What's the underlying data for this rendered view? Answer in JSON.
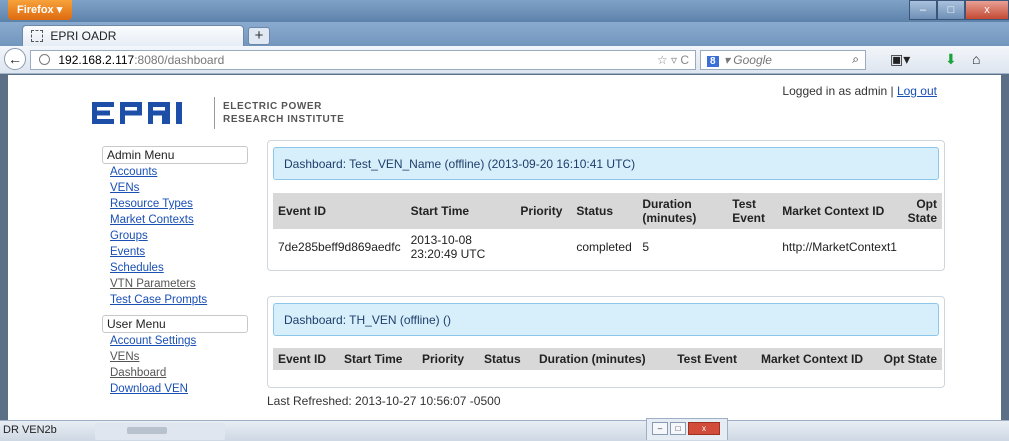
{
  "browser": {
    "menu_button": "Firefox",
    "tab_title": "EPRI OADR",
    "new_tab_glyph": "+",
    "url_host": "192.168.2.117",
    "url_path": ":8080/dashboard",
    "url_controls": "☆ ▿ C",
    "search_engine": "8",
    "search_placeholder": "Google",
    "window_controls": {
      "minimize": "–",
      "maximize": "□",
      "close": "x"
    }
  },
  "header": {
    "logo": {
      "mark": "EPRI",
      "line1": "ELECTRIC POWER",
      "line2": "RESEARCH INSTITUTE"
    },
    "logged_in_text": "Logged in as admin | ",
    "logout_label": "Log out"
  },
  "admin_menu": {
    "title": "Admin Menu",
    "items": [
      "Accounts",
      "VENs",
      "Resource Types",
      "Market Contexts",
      "Groups",
      "Events",
      "Schedules",
      "VTN Parameters",
      "Test Case Prompts"
    ]
  },
  "user_menu": {
    "title": "User Menu",
    "items": [
      "Account Settings",
      "VENs",
      "Dashboard",
      "Download VEN"
    ]
  },
  "dashboard1": {
    "title": "Dashboard: Test_VEN_Name (offline) (2013-09-20 16:10:41 UTC)",
    "columns": [
      "Event ID",
      "Start Time",
      "Priority",
      "Status",
      "Duration (minutes)",
      "Test Event",
      "Market Context ID",
      "Opt State"
    ],
    "rows": [
      {
        "event_id": "7de285beff9d869aedfc",
        "start_time": "2013-10-08 23:20:49 UTC",
        "priority": "",
        "status": "completed",
        "duration": "5",
        "test_event": "",
        "market_context": "http://MarketContext1",
        "opt_state": ""
      }
    ]
  },
  "dashboard2": {
    "title": "Dashboard: TH_VEN (offline) ()",
    "columns": [
      "Event ID",
      "Start Time",
      "Priority",
      "Status",
      "Duration (minutes)",
      "Test Event",
      "Market Context ID",
      "Opt State"
    ]
  },
  "last_refreshed": "Last Refreshed: 2013-10-27 10:56:07 -0500",
  "taskbar": {
    "label": "DR VEN2b"
  },
  "colors": {
    "link": "#1a4fb4",
    "panel_header_bg": "#d7eefb",
    "panel_header_border": "#8cc6ea",
    "table_header_bg": "#d8d8d8",
    "logo_blue": "#1e4fa8"
  }
}
